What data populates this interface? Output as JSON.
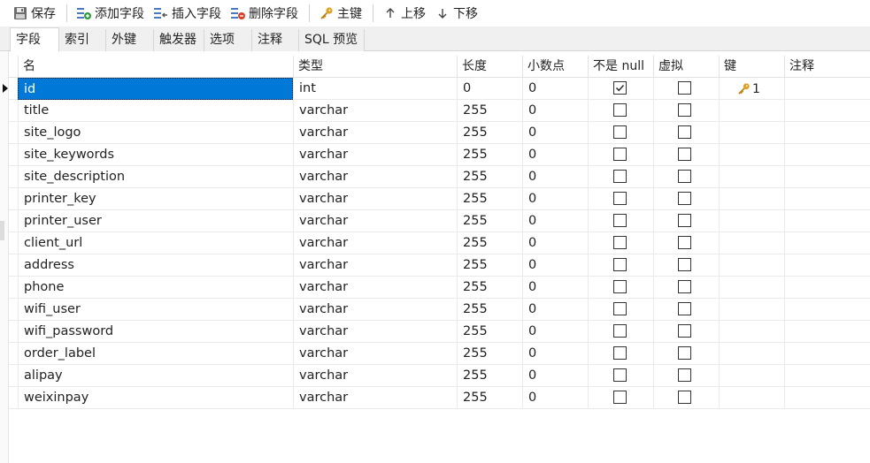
{
  "toolbar": {
    "save_label": "保存",
    "add_field_label": "添加字段",
    "insert_field_label": "插入字段",
    "delete_field_label": "删除字段",
    "primary_key_label": "主键",
    "move_up_label": "上移",
    "move_down_label": "下移"
  },
  "tabs": [
    {
      "label": "字段",
      "active": true
    },
    {
      "label": "索引",
      "active": false
    },
    {
      "label": "外键",
      "active": false
    },
    {
      "label": "触发器",
      "active": false
    },
    {
      "label": "选项",
      "active": false
    },
    {
      "label": "注释",
      "active": false
    },
    {
      "label": "SQL 预览",
      "active": false
    }
  ],
  "columns": {
    "name": "名",
    "type": "类型",
    "length": "长度",
    "decimals": "小数点",
    "not_null": "不是 null",
    "virtual": "虚拟",
    "key": "键",
    "comment": "注释"
  },
  "fields": [
    {
      "name": "id",
      "type": "int",
      "length": "0",
      "decimals": "0",
      "not_null": true,
      "virtual": false,
      "key": "1",
      "comment": "",
      "selected": true
    },
    {
      "name": "title",
      "type": "varchar",
      "length": "255",
      "decimals": "0",
      "not_null": false,
      "virtual": false,
      "key": "",
      "comment": ""
    },
    {
      "name": "site_logo",
      "type": "varchar",
      "length": "255",
      "decimals": "0",
      "not_null": false,
      "virtual": false,
      "key": "",
      "comment": ""
    },
    {
      "name": "site_keywords",
      "type": "varchar",
      "length": "255",
      "decimals": "0",
      "not_null": false,
      "virtual": false,
      "key": "",
      "comment": ""
    },
    {
      "name": "site_description",
      "type": "varchar",
      "length": "255",
      "decimals": "0",
      "not_null": false,
      "virtual": false,
      "key": "",
      "comment": ""
    },
    {
      "name": "printer_key",
      "type": "varchar",
      "length": "255",
      "decimals": "0",
      "not_null": false,
      "virtual": false,
      "key": "",
      "comment": ""
    },
    {
      "name": "printer_user",
      "type": "varchar",
      "length": "255",
      "decimals": "0",
      "not_null": false,
      "virtual": false,
      "key": "",
      "comment": ""
    },
    {
      "name": "client_url",
      "type": "varchar",
      "length": "255",
      "decimals": "0",
      "not_null": false,
      "virtual": false,
      "key": "",
      "comment": ""
    },
    {
      "name": "address",
      "type": "varchar",
      "length": "255",
      "decimals": "0",
      "not_null": false,
      "virtual": false,
      "key": "",
      "comment": ""
    },
    {
      "name": "phone",
      "type": "varchar",
      "length": "255",
      "decimals": "0",
      "not_null": false,
      "virtual": false,
      "key": "",
      "comment": ""
    },
    {
      "name": "wifi_user",
      "type": "varchar",
      "length": "255",
      "decimals": "0",
      "not_null": false,
      "virtual": false,
      "key": "",
      "comment": ""
    },
    {
      "name": "wifi_password",
      "type": "varchar",
      "length": "255",
      "decimals": "0",
      "not_null": false,
      "virtual": false,
      "key": "",
      "comment": ""
    },
    {
      "name": "order_label",
      "type": "varchar",
      "length": "255",
      "decimals": "0",
      "not_null": false,
      "virtual": false,
      "key": "",
      "comment": ""
    },
    {
      "name": "alipay",
      "type": "varchar",
      "length": "255",
      "decimals": "0",
      "not_null": false,
      "virtual": false,
      "key": "",
      "comment": ""
    },
    {
      "name": "weixinpay",
      "type": "varchar",
      "length": "255",
      "decimals": "0",
      "not_null": false,
      "virtual": false,
      "key": "",
      "comment": ""
    }
  ],
  "icons": {
    "save": "floppy-disk-icon",
    "add_field": "add-field-icon",
    "insert_field": "insert-field-icon",
    "delete_field": "delete-field-icon",
    "primary_key": "key-icon",
    "move_up": "arrow-up-icon",
    "move_down": "arrow-down-icon"
  },
  "colors": {
    "selection": "#0078d7",
    "key_gold": "#e0a020",
    "add_green": "#2e9b3a",
    "delete_red": "#d8402a"
  }
}
